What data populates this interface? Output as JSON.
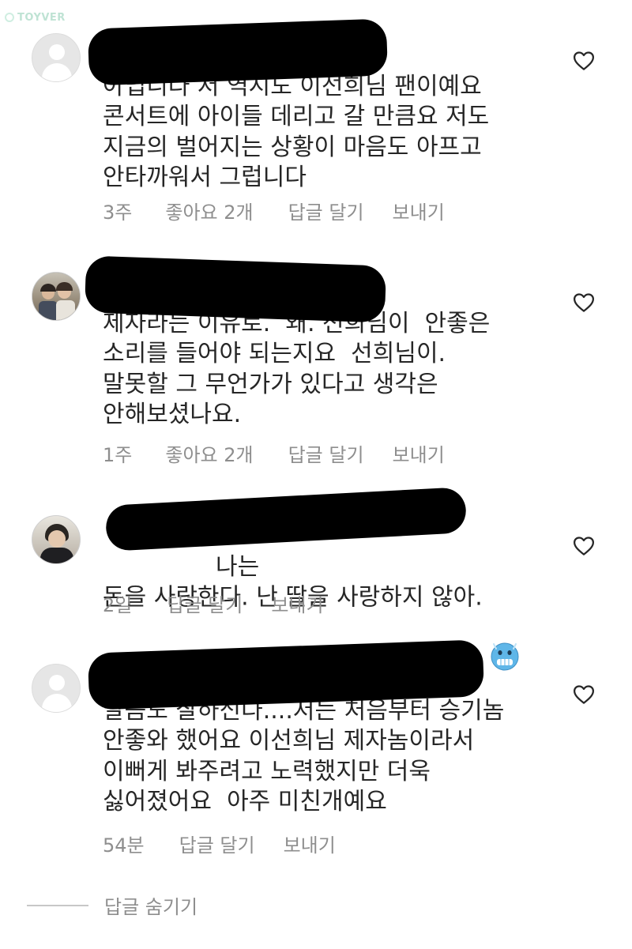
{
  "watermark": "TOYVER",
  "comments": [
    {
      "text": "           펌훼하는게\n아닙니다 저 역시도 이선희님 팬이예요\n콘서트에 아이들 데리고 갈 만큼요 저도\n지금의 벌어지는 상황이 마음도 아프고\n안타까워서 그럽니다",
      "time": "3주",
      "likes": "좋아요 2개",
      "reply": "답글 달기",
      "send": "보내기"
    },
    {
      "text": "           스승과\n제자라는 이유로.  왜. 선희님이  안좋은\n소리를 들어야 되는지요  선희님이.\n말못할 그 무언가가 있다고 생각은\n안해보셨나요.",
      "time": "1주",
      "likes": "좋아요 2개",
      "reply": "답글 달기",
      "send": "보내기"
    },
    {
      "text": "           나는\n돈을 사랑한다. 난 딸을 사랑하지 않아.",
      "time": "2일",
      "reply": "답글 달기",
      "send": "보내기"
    },
    {
      "text": "           참\n말씀도 잘하신다....저는 처음부터 승기놈\n안좋와 했어요 이선희님 제자놈이라서\n이뻐게 봐주려고 노력했지만 더욱\n싫어졌어요  아주 미친개예요",
      "time": "54분",
      "reply": "답글 달기",
      "send": "보내기"
    }
  ],
  "hide_replies": "답글 숨기기",
  "icons": {
    "like": "heart-outline-icon",
    "emoji": "cold-face-emoji-icon"
  },
  "colors": {
    "text": "#262626",
    "meta": "#8e8e8e",
    "emoji": "#5fb6e8"
  }
}
